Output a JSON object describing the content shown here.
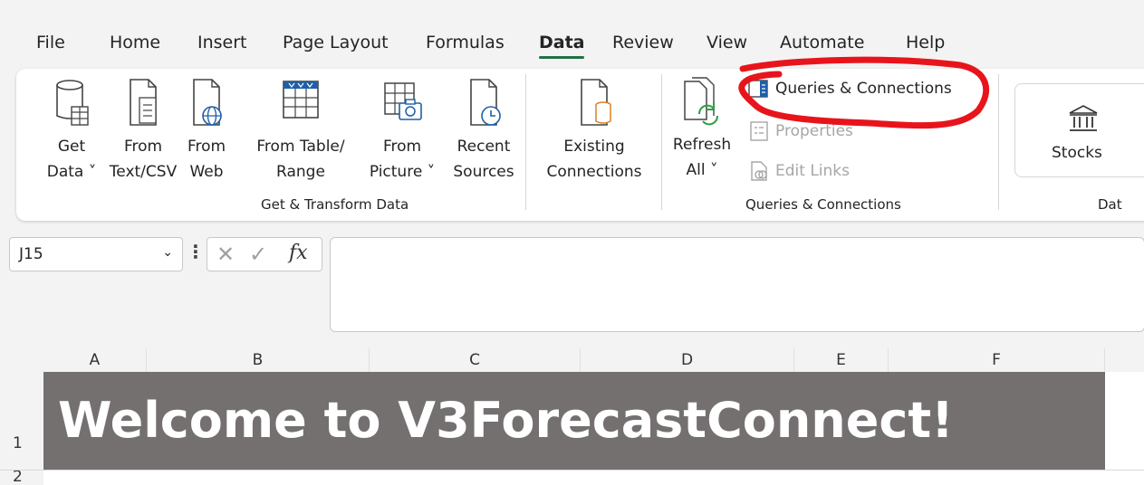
{
  "menu": {
    "tabs": [
      "File",
      "Home",
      "Insert",
      "Page Layout",
      "Formulas",
      "Data",
      "Review",
      "View",
      "Automate",
      "Help"
    ],
    "active": "Data"
  },
  "ribbon": {
    "get_transform": {
      "label": "Get & Transform Data",
      "buttons": [
        {
          "line1": "Get",
          "line2": "Data ˅",
          "icon": "database-table-icon"
        },
        {
          "line1": "From",
          "line2": "Text/CSV",
          "icon": "text-file-icon"
        },
        {
          "line1": "From",
          "line2": "Web",
          "icon": "web-file-icon"
        },
        {
          "line1": "From Table/",
          "line2": "Range",
          "icon": "table-range-icon"
        },
        {
          "line1": "From",
          "line2": "Picture ˅",
          "icon": "picture-table-icon"
        },
        {
          "line1": "Recent",
          "line2": "Sources",
          "icon": "recent-sources-icon"
        },
        {
          "line1": "Existing",
          "line2": "Connections",
          "icon": "existing-connections-icon"
        }
      ]
    },
    "queries": {
      "label": "Queries & Connections",
      "refresh_line1": "Refresh",
      "refresh_line2": "All ˅",
      "queries_connections": "Queries & Connections",
      "properties": "Properties",
      "edit_links": "Edit Links"
    },
    "data_types": {
      "stocks": "Stocks",
      "label_partial": "Dat"
    }
  },
  "formula_bar": {
    "name_box": "J15",
    "fx": "fx",
    "value": ""
  },
  "grid": {
    "columns": [
      "A",
      "B",
      "C",
      "D",
      "E",
      "F"
    ],
    "rows": [
      "1",
      "2"
    ],
    "banner_text": "Welcome to V3ForecastConnect!",
    "banner_color": "#747070"
  },
  "annotation": {
    "color": "#e8141c"
  }
}
